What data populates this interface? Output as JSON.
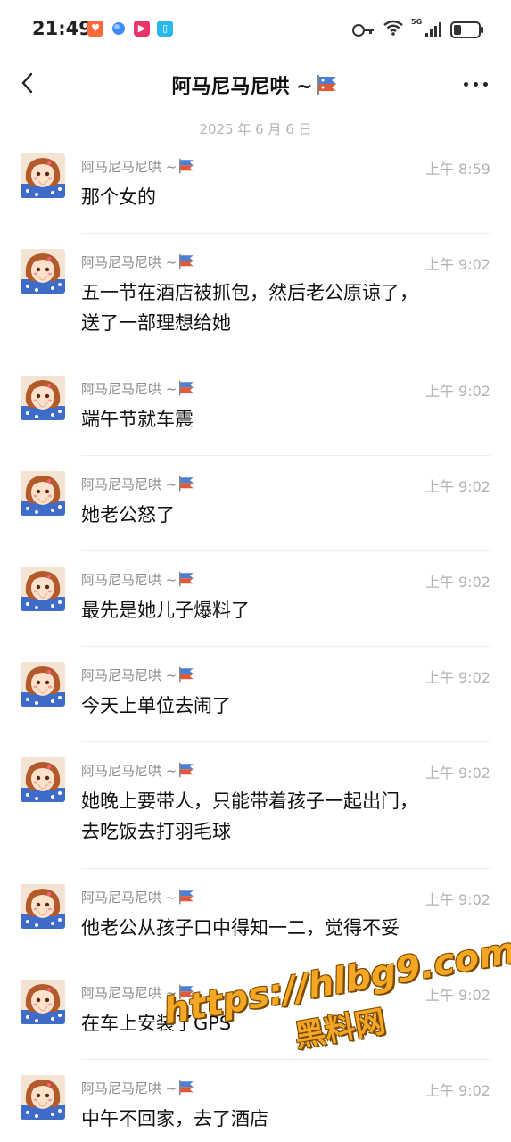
{
  "status_bar": {
    "time": "21:49",
    "app_icons": [
      "heart-app-icon",
      "blue-dot-app-icon",
      "video-play-app-icon",
      "book-app-icon"
    ],
    "network": "5G"
  },
  "header": {
    "title": "阿马尼马尼哄 ~",
    "back_icon": "chevron-left-icon",
    "more_icon": "more-dots-icon"
  },
  "date_divider": "2025 年 6 月 6 日",
  "messages": [
    {
      "sender": "阿马尼马尼哄 ~",
      "time": "上午 8:59",
      "lines": [
        "那个女的"
      ]
    },
    {
      "sender": "阿马尼马尼哄 ~",
      "time": "上午 9:02",
      "lines": [
        "五一节在酒店被抓包，然后老公原谅了，",
        "送了一部理想给她"
      ]
    },
    {
      "sender": "阿马尼马尼哄 ~",
      "time": "上午 9:02",
      "lines": [
        "端午节就车震"
      ]
    },
    {
      "sender": "阿马尼马尼哄 ~",
      "time": "上午 9:02",
      "lines": [
        "她老公怒了"
      ]
    },
    {
      "sender": "阿马尼马尼哄 ~",
      "time": "上午 9:02",
      "lines": [
        "最先是她儿子爆料了"
      ]
    },
    {
      "sender": "阿马尼马尼哄 ~",
      "time": "上午 9:02",
      "lines": [
        "今天上单位去闹了"
      ]
    },
    {
      "sender": "阿马尼马尼哄 ~",
      "time": "上午 9:02",
      "lines": [
        "她晚上要带人，只能带着孩子一起出门，",
        "去吃饭去打羽毛球"
      ]
    },
    {
      "sender": "阿马尼马尼哄 ~",
      "time": "上午 9:02",
      "lines": [
        "他老公从孩子口中得知一二，觉得不妥"
      ]
    },
    {
      "sender": "阿马尼马尼哄 ~",
      "time": "上午 9:02",
      "lines": [
        "在车上安装了GPS"
      ]
    },
    {
      "sender": "阿马尼马尼哄 ~",
      "time": "上午 9:02",
      "lines": [
        "中午不回家，去了酒店"
      ]
    }
  ],
  "watermark": {
    "url": "https://hlbg9.com",
    "name": "黑料网"
  },
  "colors": {
    "background": "#ffffff",
    "sender": "#8b8b8b",
    "time": "#b3b3b3",
    "watermark": "#f5a623"
  }
}
